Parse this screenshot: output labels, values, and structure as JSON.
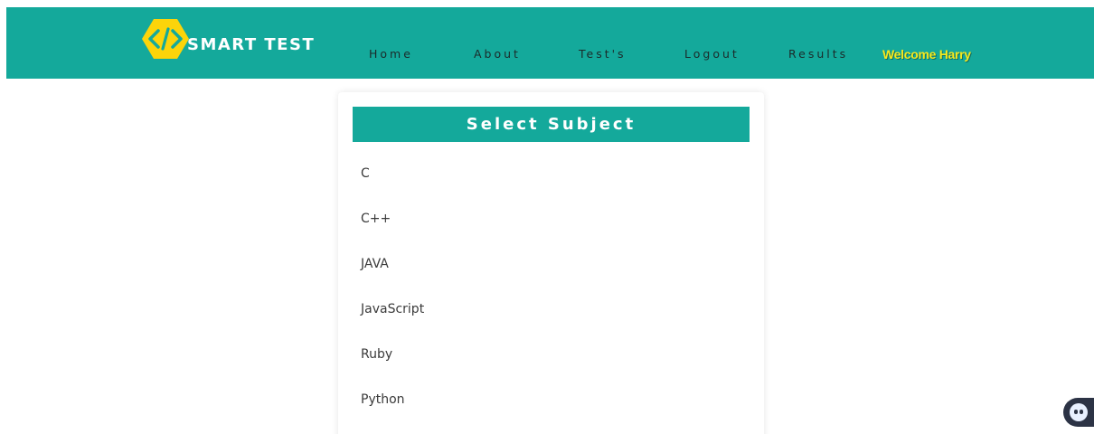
{
  "header": {
    "logo_text": "SMART TEST",
    "nav": [
      {
        "label": "Home"
      },
      {
        "label": "About"
      },
      {
        "label": "Test's"
      },
      {
        "label": "Logout"
      },
      {
        "label": "Results"
      }
    ],
    "welcome_text": "Welcome Harry"
  },
  "card": {
    "title": "Select Subject",
    "subjects": [
      "C",
      "C++",
      "JAVA",
      "JavaScript",
      "Ruby",
      "Python"
    ]
  },
  "colors": {
    "primary": "#14a99b",
    "accent_yellow": "#f6e81c",
    "logo_yellow": "#fcd40a"
  },
  "icons": {
    "logo": "code-brackets-icon",
    "chat": "chatbot-icon"
  }
}
